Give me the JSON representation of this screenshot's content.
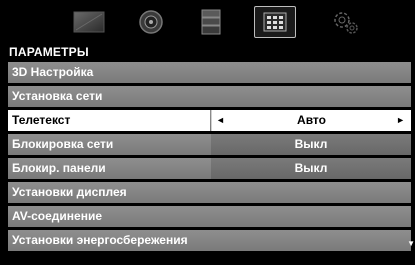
{
  "tabs": [
    {
      "icon": "picture-icon"
    },
    {
      "icon": "sound-icon"
    },
    {
      "icon": "media-icon"
    },
    {
      "icon": "setup-grid-icon",
      "active": true
    },
    {
      "icon": "settings-gears-icon"
    }
  ],
  "menu": {
    "title": "ПАРАМЕТРЫ",
    "items": [
      {
        "label": "3D Настройка"
      },
      {
        "label": "Установка сети"
      },
      {
        "label": "Телетекст",
        "value": "Авто",
        "selected": true
      },
      {
        "label": "Блокировка сети",
        "value": "Выкл"
      },
      {
        "label": "Блокир. панели",
        "value": "Выкл"
      },
      {
        "label": "Установки дисплея"
      },
      {
        "label": "AV-соединение"
      },
      {
        "label": "Установки энергосбережения"
      }
    ],
    "arrow_left": "◄",
    "arrow_right": "►",
    "scroll_indicator": "▼"
  }
}
